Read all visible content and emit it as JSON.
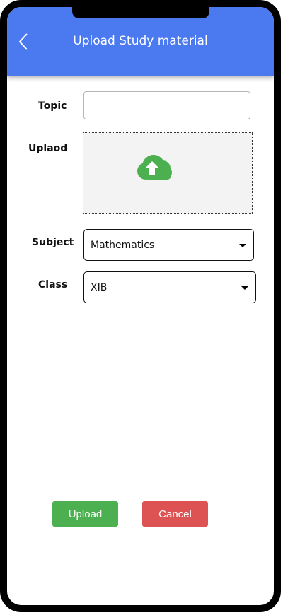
{
  "header": {
    "title": "Upload Study material",
    "back_icon": "chevron-left-icon"
  },
  "form": {
    "topic_label": "Topic",
    "topic_value": "",
    "upload_label": "Uplaod",
    "upload_icon": "cloud-upload-icon",
    "subject_label": "Subject",
    "subject_value": "Mathematics",
    "class_label": "Class",
    "class_value": "XIB"
  },
  "actions": {
    "upload_label": "Upload",
    "cancel_label": "Cancel"
  },
  "colors": {
    "header": "#4a79f0",
    "upload_button": "#4caf50",
    "cancel_button": "#dd5252",
    "cloud_icon": "#4caf50"
  }
}
